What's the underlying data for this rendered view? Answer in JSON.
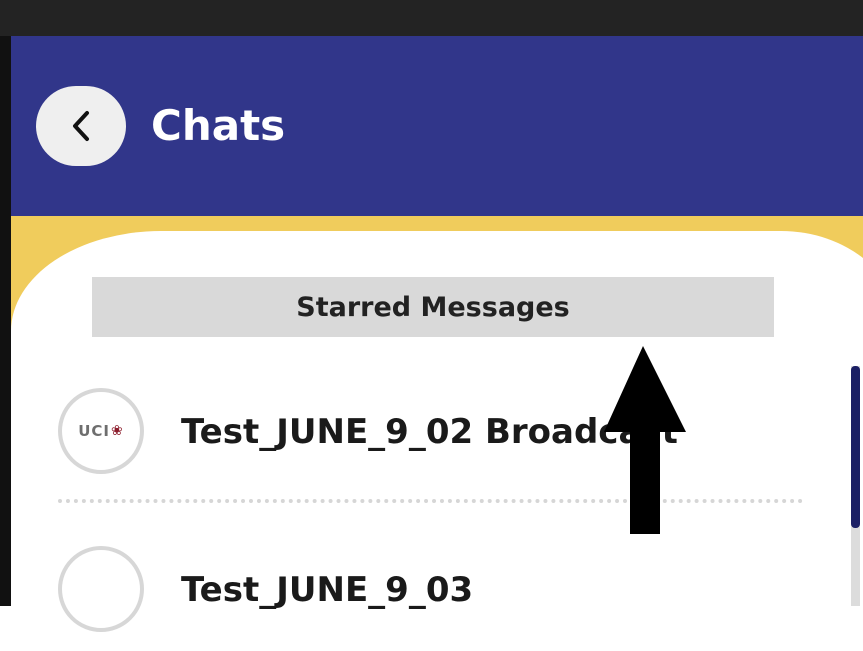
{
  "header": {
    "title": "Chats",
    "back_icon": "chevron-left-icon"
  },
  "starred": {
    "label": "Starred Messages"
  },
  "chats": [
    {
      "name": "Test_JUNE_9_02 Broadcast",
      "avatar_logo": "UCI",
      "avatar_mark": "❀"
    },
    {
      "name": "Test_JUNE_9_03",
      "avatar_logo": ""
    }
  ],
  "colors": {
    "header_bg": "#31368a",
    "accent_yellow": "#f0cc5c",
    "starred_bg": "#d9d9d9",
    "scrollbar": "#1b1f64"
  },
  "annotation": {
    "type": "arrow-up",
    "color": "#000000"
  }
}
